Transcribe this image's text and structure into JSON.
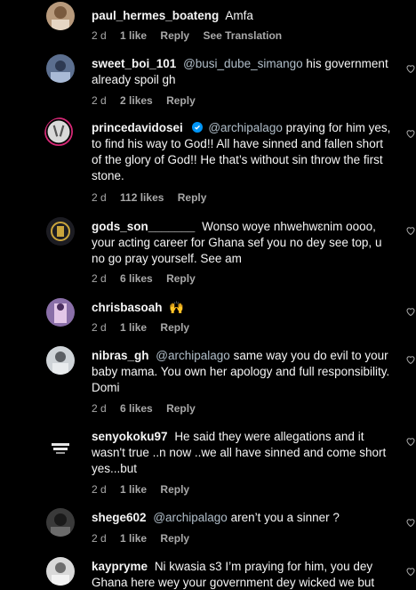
{
  "comments": [
    {
      "username": "paul_hermes_boateng",
      "mention": "",
      "text": "Amfa",
      "time": "2 d",
      "likes": "1 like",
      "reply": "Reply",
      "translate": "See Translation"
    },
    {
      "username": "sweet_boi_101",
      "mention": "@busi_dube_simango",
      "text": "his government already spoil gh",
      "time": "2 d",
      "likes": "2 likes",
      "reply": "Reply"
    },
    {
      "username": "princedavidosei",
      "mention": "@archipalago",
      "text": "praying for him yes, to find his way to God!! All have sinned and fallen short of the glory of God!! He that’s without sin throw the first stone.",
      "time": "2 d",
      "likes": "112 likes",
      "reply": "Reply"
    },
    {
      "username": "gods_son_______",
      "mention": "",
      "text": "Wonso woye nhwehwɛnim oooo, your acting career for Ghana sef you no dey see top, u no go pray yourself. See am",
      "time": "2 d",
      "likes": "6 likes",
      "reply": "Reply"
    },
    {
      "username": "chrisbasoah",
      "mention": "",
      "text": "🙌",
      "time": "2 d",
      "likes": "1 like",
      "reply": "Reply"
    },
    {
      "username": "nibras_gh",
      "mention": "@archipalago",
      "text": "same way you do evil to your baby mama. You own her apology and full responsibility. Domi",
      "time": "2 d",
      "likes": "6 likes",
      "reply": "Reply"
    },
    {
      "username": "senyokoku97",
      "mention": "",
      "text": "He said they were allegations and it wasn't true ..n now ..we all have sinned and come short yes...but",
      "time": "2 d",
      "likes": "1 like",
      "reply": "Reply"
    },
    {
      "username": "shege602",
      "mention": "@archipalago",
      "text": "aren’t you a sinner ?",
      "time": "2 d",
      "likes": "1 like",
      "reply": "Reply"
    },
    {
      "username": "kaypryme",
      "mention": "",
      "text": "Ni kwasia s3 I’m praying for him, you dey Ghana here wey your government dey wicked we but",
      "time": "",
      "likes": "",
      "reply": ""
    }
  ],
  "icons": {
    "like": "heart-outline-icon",
    "verified": "verified-badge-icon"
  },
  "colors": {
    "background": "#000000",
    "text": "#f5f5f5",
    "secondary": "#a8a8a8",
    "mention": "#e0f1ff",
    "verified": "#0095f6"
  }
}
